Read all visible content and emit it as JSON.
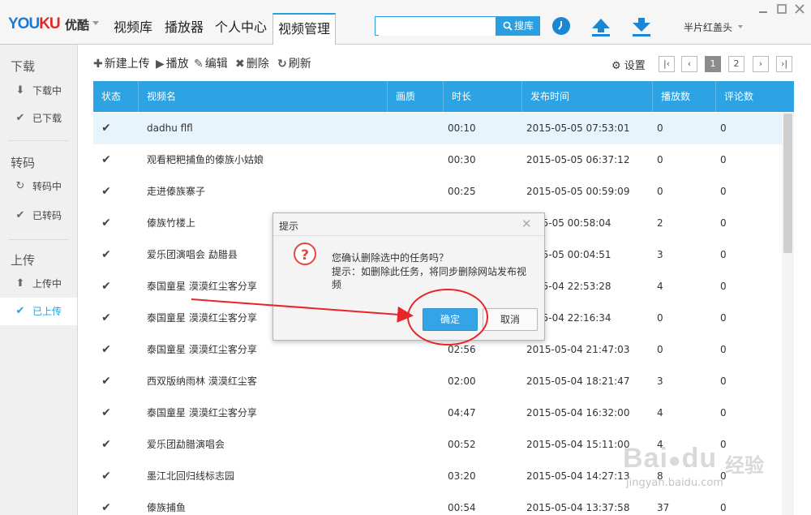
{
  "app": {
    "logo_text_a": "YOU",
    "logo_text_b": "KU",
    "logo_cn": "优酷",
    "nav_tabs": [
      "视频库",
      "播放器",
      "个人中心",
      "视频管理"
    ],
    "search_button": "搜库",
    "search_value": "",
    "user_name": "半片红盖头",
    "window_controls": [
      "minimize-icon",
      "maximize-icon",
      "close-icon"
    ]
  },
  "sidebar": {
    "sections": [
      {
        "title": "下载",
        "items": [
          {
            "icon": "download-icon",
            "label": "下载中"
          },
          {
            "icon": "check-icon",
            "label": "已下载"
          }
        ]
      },
      {
        "title": "转码",
        "items": [
          {
            "icon": "refresh-icon",
            "label": "转码中"
          },
          {
            "icon": "check-icon",
            "label": "已转码"
          }
        ]
      },
      {
        "title": "上传",
        "items": [
          {
            "icon": "upload-icon",
            "label": "上传中"
          },
          {
            "icon": "check-icon",
            "label": "已上传"
          }
        ]
      }
    ],
    "active_item": "已上传"
  },
  "toolbar": {
    "new_upload": "新建上传",
    "play": "播放",
    "edit": "编辑",
    "delete": "删除",
    "refresh": "刷新",
    "settings": "设置",
    "pages": [
      "1",
      "2"
    ],
    "current_page": "1"
  },
  "table": {
    "columns": [
      "状态",
      "视频名",
      "画质",
      "时长",
      "发布时间",
      "播放数",
      "评论数"
    ],
    "rows": [
      {
        "name": "dadhu flfl",
        "quality": "",
        "duration": "00:10",
        "published": "2015-05-05 07:53:01",
        "plays": "0",
        "comments": "0"
      },
      {
        "name": "观看粑粑捕鱼的傣族小姑娘",
        "quality": "",
        "duration": "00:30",
        "published": "2015-05-05 06:37:12",
        "plays": "0",
        "comments": "0"
      },
      {
        "name": "走进傣族寨子",
        "quality": "",
        "duration": "00:25",
        "published": "2015-05-05 00:59:09",
        "plays": "0",
        "comments": "0"
      },
      {
        "name": "傣族竹楼上",
        "quality": "",
        "duration": "",
        "published": "5-05-05 00:58:04",
        "plays": "2",
        "comments": "0"
      },
      {
        "name": "爱乐团演唱会  勐腊县",
        "quality": "",
        "duration": "",
        "published": "5-05-05 00:04:51",
        "plays": "3",
        "comments": "0"
      },
      {
        "name": "泰国童星  漠漠红尘客分享",
        "quality": "",
        "duration": "",
        "published": "5-05-04 22:53:28",
        "plays": "4",
        "comments": "0"
      },
      {
        "name": "泰国童星  漠漠红尘客分享",
        "quality": "",
        "duration": "",
        "published": "5-05-04 22:16:34",
        "plays": "0",
        "comments": "0"
      },
      {
        "name": "泰国童星  漠漠红尘客分享",
        "quality": "",
        "duration": "02:56",
        "published": "2015-05-04 21:47:03",
        "plays": "0",
        "comments": "0"
      },
      {
        "name": "西双版纳雨林  漠漠红尘客",
        "quality": "",
        "duration": "02:00",
        "published": "2015-05-04 18:21:47",
        "plays": "3",
        "comments": "0"
      },
      {
        "name": "泰国童星  漠漠红尘客分享",
        "quality": "",
        "duration": "04:47",
        "published": "2015-05-04 16:32:00",
        "plays": "4",
        "comments": "0"
      },
      {
        "name": "爱乐团勐腊演唱会",
        "quality": "",
        "duration": "00:52",
        "published": "2015-05-04 15:11:00",
        "plays": "4",
        "comments": "0"
      },
      {
        "name": "墨江北回归线标志园",
        "quality": "",
        "duration": "03:20",
        "published": "2015-05-04 14:27:13",
        "plays": "8",
        "comments": "0"
      },
      {
        "name": "傣族捕鱼",
        "quality": "",
        "duration": "00:54",
        "published": "2015-05-04 13:37:58",
        "plays": "37",
        "comments": "0"
      }
    ]
  },
  "dialog": {
    "title": "提示",
    "message": "您确认删除选中的任务吗？",
    "hint": "提示：如删除此任务，将同步删除网站发布视频",
    "ok": "确定",
    "cancel": "取消"
  },
  "watermark": {
    "brand": "Bai",
    "brand2": "du",
    "cn": "经验",
    "url": "jingyan.baidu.com"
  },
  "colors": {
    "accent": "#2ea3e3",
    "annotation": "#e8262a",
    "alert": "#e04a3c"
  }
}
